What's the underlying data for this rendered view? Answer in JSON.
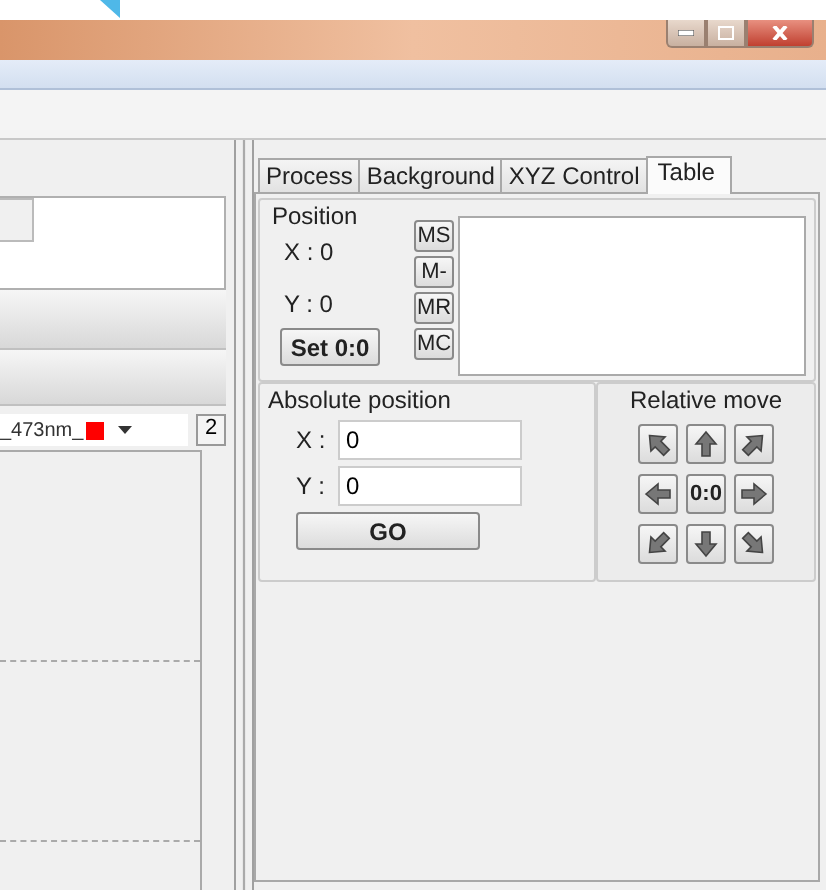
{
  "left_pane": {
    "channel_select": {
      "value": "_473nm_",
      "color": "#ff0000"
    },
    "channel_number": "2"
  },
  "tabs": [
    {
      "label": "Process",
      "selected": false
    },
    {
      "label": "Background",
      "selected": false
    },
    {
      "label": "XYZ Control",
      "selected": false
    },
    {
      "label": "Table",
      "selected": true
    }
  ],
  "position": {
    "title": "Position",
    "x_reading": "X : 0",
    "y_reading": "Y : 0",
    "set_button": "Set 0:0",
    "memory_buttons": [
      "MS",
      "M-",
      "MR",
      "MC"
    ]
  },
  "absolute_position": {
    "title": "Absolute position",
    "fields": [
      {
        "label": "X :",
        "value": "0"
      },
      {
        "label": "Y :",
        "value": "0"
      }
    ],
    "go_button": "GO"
  },
  "relative_move": {
    "title": "Relative move",
    "buttons": [
      {
        "kind": "up-left"
      },
      {
        "kind": "up"
      },
      {
        "kind": "up-right"
      },
      {
        "kind": "left"
      },
      {
        "kind": "center",
        "label": "0:0"
      },
      {
        "kind": "right"
      },
      {
        "kind": "down-left"
      },
      {
        "kind": "down"
      },
      {
        "kind": "down-right"
      }
    ]
  }
}
